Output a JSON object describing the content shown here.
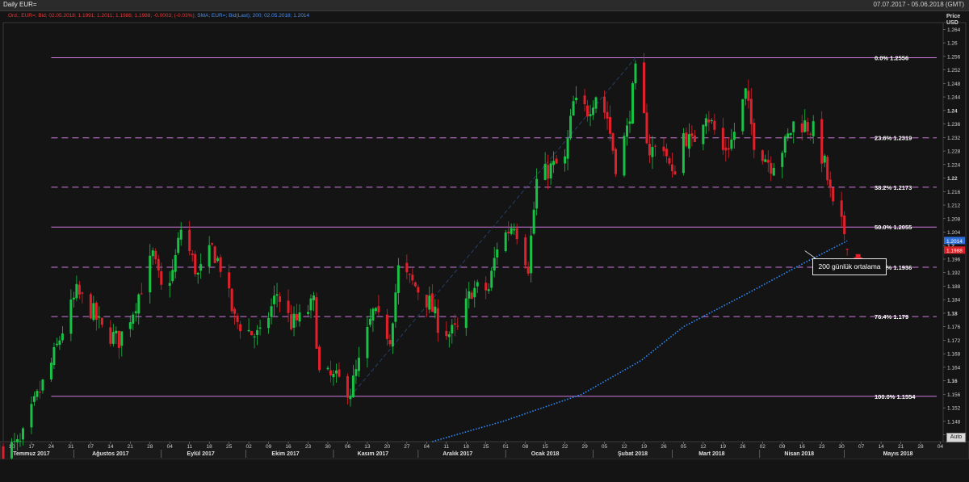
{
  "header": {
    "title": "Daily EUR=",
    "date_range": "07.07.2017 - 05.06.2018 (GMT)"
  },
  "legend": {
    "ohlc_text": "Ord.; EUR=; Bid; 02.05.2018; 1.1991; 1.2011; 1.1986; 1.1988; -0.0003; (-0.03%);",
    "sma_text": "SMA; EUR=; Bid(Last); 200; 02.05.2018; 1.2014"
  },
  "price_axis": {
    "head_line1": "Price",
    "head_line2": "USD",
    "auto_label": "Auto",
    "sma_badge": "1.2014",
    "last_badge": "1.1988"
  },
  "annotation": {
    "label": "200 günlük ortalama"
  },
  "colors": {
    "background": "#141414",
    "up_candle": "#19c145",
    "down_candle": "#e0202a",
    "sma": "#2f8cff",
    "fib_line": "#d17be0",
    "trend": "#2a4a7a"
  },
  "chart_data": {
    "type": "candlestick",
    "title": "Daily EUR=",
    "ylabel": "Price USD",
    "ylim": [
      1.142,
      1.266
    ],
    "yticks": [
      1.144,
      1.148,
      1.152,
      1.156,
      1.16,
      1.164,
      1.168,
      1.172,
      1.176,
      1.18,
      1.184,
      1.188,
      1.192,
      1.196,
      1.2,
      1.204,
      1.208,
      1.212,
      1.216,
      1.22,
      1.224,
      1.228,
      1.232,
      1.236,
      1.24,
      1.244,
      1.248,
      1.252,
      1.256,
      1.26,
      1.264
    ],
    "ytick_labels": [
      "1.144",
      "1.148",
      "1.152",
      "1.156",
      "1.16",
      "1.164",
      "1.168",
      "1.172",
      "1.176",
      "1.18",
      "1.184",
      "1.188",
      "1.192",
      "1.196",
      "1.2",
      "1.204",
      "1.208",
      "1.212",
      "1.216",
      "1.22",
      "1.224",
      "1.228",
      "1.232",
      "1.236",
      "1.24",
      "1.244",
      "1.248",
      "1.252",
      "1.256",
      "1.26",
      "1.264"
    ],
    "x_start": "2017-07-07",
    "x_end": "2018-06-05",
    "x_day_ticks": [
      {
        "date": "2017-07-10",
        "label": "10"
      },
      {
        "date": "2017-07-17",
        "label": "17"
      },
      {
        "date": "2017-07-24",
        "label": "24"
      },
      {
        "date": "2017-07-31",
        "label": "31"
      },
      {
        "date": "2017-08-07",
        "label": "07"
      },
      {
        "date": "2017-08-14",
        "label": "14"
      },
      {
        "date": "2017-08-21",
        "label": "21"
      },
      {
        "date": "2017-08-28",
        "label": "28"
      },
      {
        "date": "2017-09-04",
        "label": "04"
      },
      {
        "date": "2017-09-11",
        "label": "11"
      },
      {
        "date": "2017-09-18",
        "label": "18"
      },
      {
        "date": "2017-09-25",
        "label": "25"
      },
      {
        "date": "2017-10-02",
        "label": "02"
      },
      {
        "date": "2017-10-09",
        "label": "09"
      },
      {
        "date": "2017-10-16",
        "label": "16"
      },
      {
        "date": "2017-10-23",
        "label": "23"
      },
      {
        "date": "2017-10-30",
        "label": "30"
      },
      {
        "date": "2017-11-06",
        "label": "06"
      },
      {
        "date": "2017-11-13",
        "label": "13"
      },
      {
        "date": "2017-11-20",
        "label": "20"
      },
      {
        "date": "2017-11-27",
        "label": "27"
      },
      {
        "date": "2017-12-04",
        "label": "04"
      },
      {
        "date": "2017-12-11",
        "label": "11"
      },
      {
        "date": "2017-12-18",
        "label": "18"
      },
      {
        "date": "2017-12-25",
        "label": "25"
      },
      {
        "date": "2018-01-01",
        "label": "01"
      },
      {
        "date": "2018-01-08",
        "label": "08"
      },
      {
        "date": "2018-01-15",
        "label": "15"
      },
      {
        "date": "2018-01-22",
        "label": "22"
      },
      {
        "date": "2018-01-29",
        "label": "29"
      },
      {
        "date": "2018-02-05",
        "label": "05"
      },
      {
        "date": "2018-02-12",
        "label": "12"
      },
      {
        "date": "2018-02-19",
        "label": "19"
      },
      {
        "date": "2018-02-26",
        "label": "26"
      },
      {
        "date": "2018-03-05",
        "label": "05"
      },
      {
        "date": "2018-03-12",
        "label": "12"
      },
      {
        "date": "2018-03-19",
        "label": "19"
      },
      {
        "date": "2018-03-26",
        "label": "26"
      },
      {
        "date": "2018-04-02",
        "label": "02"
      },
      {
        "date": "2018-04-09",
        "label": "09"
      },
      {
        "date": "2018-04-16",
        "label": "16"
      },
      {
        "date": "2018-04-23",
        "label": "23"
      },
      {
        "date": "2018-04-30",
        "label": "30"
      },
      {
        "date": "2018-05-07",
        "label": "07"
      },
      {
        "date": "2018-05-14",
        "label": "14"
      },
      {
        "date": "2018-05-21",
        "label": "21"
      },
      {
        "date": "2018-05-28",
        "label": "28"
      },
      {
        "date": "2018-06-04",
        "label": "04"
      }
    ],
    "x_month_labels": [
      {
        "date": "2017-07-17",
        "label": "Temmuz 2017"
      },
      {
        "date": "2017-08-14",
        "label": "Ağustos 2017"
      },
      {
        "date": "2017-09-15",
        "label": "Eylül 2017"
      },
      {
        "date": "2017-10-15",
        "label": "Ekim 2017"
      },
      {
        "date": "2017-11-15",
        "label": "Kasım 2017"
      },
      {
        "date": "2017-12-15",
        "label": "Aralık 2017"
      },
      {
        "date": "2018-01-15",
        "label": "Ocak 2018"
      },
      {
        "date": "2018-02-15",
        "label": "Şubat 2018"
      },
      {
        "date": "2018-03-15",
        "label": "Mart 2018"
      },
      {
        "date": "2018-04-15",
        "label": "Nisan 2018"
      },
      {
        "date": "2018-05-20",
        "label": "Mayıs 2018"
      }
    ],
    "x_month_boundaries": [
      "2017-08-01",
      "2017-09-01",
      "2017-10-01",
      "2017-11-01",
      "2017-12-01",
      "2018-01-01",
      "2018-02-01",
      "2018-03-01",
      "2018-04-01",
      "2018-05-01"
    ],
    "fib_levels": [
      {
        "label": "0.0%",
        "value": 1.2556,
        "value_label": "1.2556",
        "style": "solid"
      },
      {
        "label": "23.6%",
        "value": 1.2319,
        "value_label": "1.2319",
        "style": "dashed"
      },
      {
        "label": "38.2%",
        "value": 1.2173,
        "value_label": "1.2173",
        "style": "dashed"
      },
      {
        "label": "50.0%",
        "value": 1.2055,
        "value_label": "1.2055",
        "style": "solid"
      },
      {
        "label": "61.8%",
        "value": 1.1936,
        "value_label": "1.1936",
        "style": "dashed"
      },
      {
        "label": "76.4%",
        "value": 1.179,
        "value_label": "1.179",
        "style": "dashed"
      },
      {
        "label": "100.0%",
        "value": 1.1554,
        "value_label": "1.1554",
        "style": "solid"
      }
    ],
    "fib_start_date": "2017-07-24",
    "fib_end_date": "2018-05-17",
    "trendline": [
      {
        "date": "2017-11-07",
        "y": 1.1554
      },
      {
        "date": "2018-02-16",
        "y": 1.2556
      }
    ],
    "arrow": {
      "date": "2018-05-03",
      "y": 1.1975
    },
    "callout_anchor": {
      "date": "2018-04-17",
      "y": 1.1985
    },
    "last_close": 1.1988,
    "sma_last": 1.2014,
    "price_path": [
      {
        "date": "2017-07-07",
        "y": 1.14
      },
      {
        "date": "2017-07-13",
        "y": 1.141
      },
      {
        "date": "2017-07-18",
        "y": 1.153
      },
      {
        "date": "2017-07-24",
        "y": 1.165
      },
      {
        "date": "2017-07-28",
        "y": 1.175
      },
      {
        "date": "2017-08-02",
        "y": 1.186
      },
      {
        "date": "2017-08-08",
        "y": 1.18
      },
      {
        "date": "2017-08-11",
        "y": 1.175
      },
      {
        "date": "2017-08-17",
        "y": 1.172
      },
      {
        "date": "2017-08-22",
        "y": 1.181
      },
      {
        "date": "2017-08-29",
        "y": 1.197
      },
      {
        "date": "2017-09-01",
        "y": 1.187
      },
      {
        "date": "2017-09-05",
        "y": 1.192
      },
      {
        "date": "2017-09-08",
        "y": 1.205
      },
      {
        "date": "2017-09-14",
        "y": 1.191
      },
      {
        "date": "2017-09-19",
        "y": 1.199
      },
      {
        "date": "2017-09-22",
        "y": 1.194
      },
      {
        "date": "2017-09-27",
        "y": 1.178
      },
      {
        "date": "2017-10-03",
        "y": 1.174
      },
      {
        "date": "2017-10-06",
        "y": 1.173
      },
      {
        "date": "2017-10-12",
        "y": 1.186
      },
      {
        "date": "2017-10-17",
        "y": 1.177
      },
      {
        "date": "2017-10-20",
        "y": 1.178
      },
      {
        "date": "2017-10-25",
        "y": 1.183
      },
      {
        "date": "2017-10-27",
        "y": 1.162
      },
      {
        "date": "2017-11-03",
        "y": 1.16
      },
      {
        "date": "2017-11-07",
        "y": 1.157
      },
      {
        "date": "2017-11-10",
        "y": 1.165
      },
      {
        "date": "2017-11-15",
        "y": 1.18
      },
      {
        "date": "2017-11-21",
        "y": 1.173
      },
      {
        "date": "2017-11-24",
        "y": 1.193
      },
      {
        "date": "2017-11-30",
        "y": 1.188
      },
      {
        "date": "2017-12-05",
        "y": 1.183
      },
      {
        "date": "2017-12-08",
        "y": 1.177
      },
      {
        "date": "2017-12-12",
        "y": 1.174
      },
      {
        "date": "2017-12-15",
        "y": 1.175
      },
      {
        "date": "2017-12-20",
        "y": 1.187
      },
      {
        "date": "2017-12-26",
        "y": 1.187
      },
      {
        "date": "2017-12-29",
        "y": 1.2
      },
      {
        "date": "2018-01-04",
        "y": 1.207
      },
      {
        "date": "2018-01-09",
        "y": 1.194
      },
      {
        "date": "2018-01-12",
        "y": 1.219
      },
      {
        "date": "2018-01-17",
        "y": 1.223
      },
      {
        "date": "2018-01-22",
        "y": 1.225
      },
      {
        "date": "2018-01-25",
        "y": 1.242
      },
      {
        "date": "2018-01-30",
        "y": 1.24
      },
      {
        "date": "2018-02-02",
        "y": 1.245
      },
      {
        "date": "2018-02-06",
        "y": 1.238
      },
      {
        "date": "2018-02-09",
        "y": 1.224
      },
      {
        "date": "2018-02-13",
        "y": 1.234
      },
      {
        "date": "2018-02-16",
        "y": 1.251
      },
      {
        "date": "2018-02-21",
        "y": 1.228
      },
      {
        "date": "2018-02-26",
        "y": 1.23
      },
      {
        "date": "2018-03-01",
        "y": 1.22
      },
      {
        "date": "2018-03-05",
        "y": 1.233
      },
      {
        "date": "2018-03-08",
        "y": 1.23
      },
      {
        "date": "2018-03-13",
        "y": 1.24
      },
      {
        "date": "2018-03-19",
        "y": 1.228
      },
      {
        "date": "2018-03-22",
        "y": 1.231
      },
      {
        "date": "2018-03-27",
        "y": 1.245
      },
      {
        "date": "2018-03-30",
        "y": 1.231
      },
      {
        "date": "2018-04-05",
        "y": 1.224
      },
      {
        "date": "2018-04-10",
        "y": 1.23
      },
      {
        "date": "2018-04-13",
        "y": 1.236
      },
      {
        "date": "2018-04-17",
        "y": 1.236
      },
      {
        "date": "2018-04-20",
        "y": 1.234
      },
      {
        "date": "2018-04-24",
        "y": 1.224
      },
      {
        "date": "2018-04-27",
        "y": 1.211
      },
      {
        "date": "2018-05-01",
        "y": 1.204
      },
      {
        "date": "2018-05-02",
        "y": 1.1988
      }
    ],
    "sma_path": [
      {
        "date": "2017-12-06",
        "y": 1.142
      },
      {
        "date": "2017-12-31",
        "y": 1.148
      },
      {
        "date": "2018-01-28",
        "y": 1.156
      },
      {
        "date": "2018-02-18",
        "y": 1.166
      },
      {
        "date": "2018-03-05",
        "y": 1.176
      },
      {
        "date": "2018-03-28",
        "y": 1.186
      },
      {
        "date": "2018-04-17",
        "y": 1.195
      },
      {
        "date": "2018-05-02",
        "y": 1.2014
      }
    ]
  }
}
